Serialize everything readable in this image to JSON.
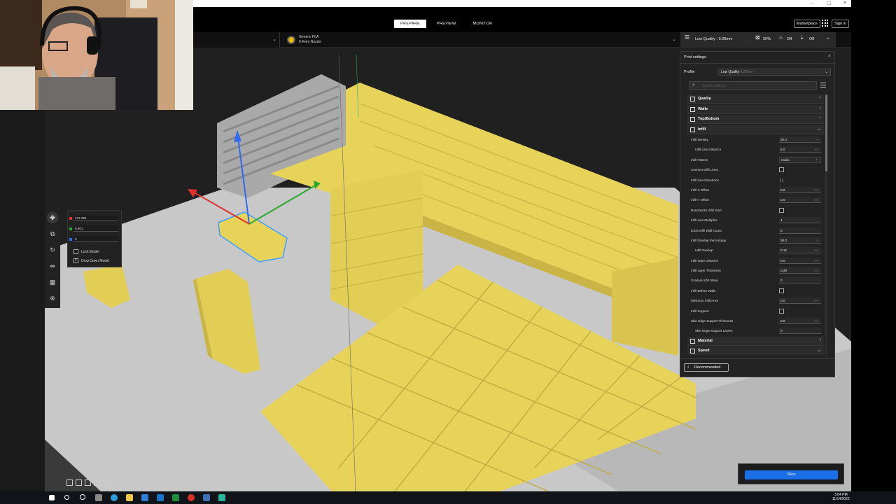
{
  "window": {
    "min_glyph": "–",
    "max_glyph": "□",
    "close_glyph": "✕"
  },
  "header": {
    "tabs": [
      {
        "label": "PREPARE",
        "active": true
      },
      {
        "label": "PREVIEW",
        "active": false
      },
      {
        "label": "MONITOR",
        "active": false
      }
    ],
    "marketplace_label": "Marketplace",
    "signin_label": "Sign in"
  },
  "toolbar": {
    "material_name": "Generic PLA",
    "nozzle": "0.4mm Nozzle",
    "quality_summary": "Low Quality - 0.28mm",
    "infill_summary": "20%",
    "support_summary": "Off",
    "adhesion_summary": "Off",
    "material_color": "#e6b800"
  },
  "print_settings": {
    "title": "Print settings",
    "profile_label": "Profile",
    "profile_value": "Low Quality",
    "profile_value_dim": "0.28mm",
    "search_placeholder": "Search settings",
    "categories_top": [
      {
        "label": "Quality",
        "icon": "quality-icon",
        "expanded": false
      },
      {
        "label": "Walls",
        "icon": "walls-icon",
        "expanded": false
      },
      {
        "label": "Top/Bottom",
        "icon": "top-bottom-icon",
        "expanded": false
      },
      {
        "label": "Infill",
        "icon": "infill-icon",
        "expanded": true
      }
    ],
    "infill_rows": [
      {
        "label": "Infill Density",
        "type": "value",
        "value": "20.0",
        "unit": "%",
        "indent": false
      },
      {
        "label": "Infill Line Distance",
        "type": "value",
        "value": "6.0",
        "unit": "mm",
        "indent": true
      },
      {
        "label": "Infill Pattern",
        "type": "dropdown",
        "value": "Cubic",
        "indent": false
      },
      {
        "label": "Connect Infill Lines",
        "type": "check",
        "value": "",
        "indent": false
      },
      {
        "label": "Infill Line Directions",
        "type": "text",
        "value": "[ ]",
        "indent": false
      },
      {
        "label": "Infill X Offset",
        "type": "value",
        "value": "0.0",
        "unit": "mm",
        "indent": false
      },
      {
        "label": "Infill Y Offset",
        "type": "value",
        "value": "0.0",
        "unit": "mm",
        "indent": false
      },
      {
        "label": "Randomize Infill Start",
        "type": "check",
        "value": "",
        "indent": false
      },
      {
        "label": "Infill Line Multiplier",
        "type": "value",
        "value": "1",
        "unit": "",
        "indent": false
      },
      {
        "label": "Extra Infill Wall Count",
        "type": "value",
        "value": "0",
        "unit": "",
        "indent": false
      },
      {
        "label": "Infill Overlap Percentage",
        "type": "value",
        "value": "30.0",
        "unit": "%",
        "indent": false
      },
      {
        "label": "Infill Overlap",
        "type": "value",
        "value": "0.12",
        "unit": "mm",
        "indent": true
      },
      {
        "label": "Infill Wipe Distance",
        "type": "value",
        "value": "0.0",
        "unit": "mm",
        "indent": false
      },
      {
        "label": "Infill Layer Thickness",
        "type": "value",
        "value": "0.28",
        "unit": "mm",
        "indent": false
      },
      {
        "label": "Gradual Infill Steps",
        "type": "value",
        "value": "0",
        "unit": "",
        "indent": false
      },
      {
        "label": "Infill Before Walls",
        "type": "check",
        "value": "",
        "indent": false
      },
      {
        "label": "Minimum Infill Area",
        "type": "value",
        "value": "0.0",
        "unit": "mm²",
        "indent": false
      },
      {
        "label": "Infill Support",
        "type": "check",
        "value": "",
        "indent": false
      },
      {
        "label": "Skin Edge Support Thickness",
        "type": "value",
        "value": "0.0",
        "unit": "mm",
        "indent": false
      },
      {
        "label": "Skin Edge Support Layers",
        "type": "value",
        "value": "0",
        "unit": "",
        "indent": true
      }
    ],
    "categories_bottom": [
      {
        "label": "Material",
        "icon": "material-icon",
        "expanded": false
      },
      {
        "label": "Speed",
        "icon": "speed-icon",
        "expanded": true
      }
    ],
    "recommended_label": "Recommended"
  },
  "move_tool": {
    "x_value": "107.294",
    "y_value": "8.801",
    "z_value": "0",
    "lock_model_label": "Lock Model",
    "drop_down_label": "Drop Down Model"
  },
  "slice_label": "Slice",
  "taskbar": {
    "time": "3:04 PM",
    "date": "11/14/2022"
  }
}
